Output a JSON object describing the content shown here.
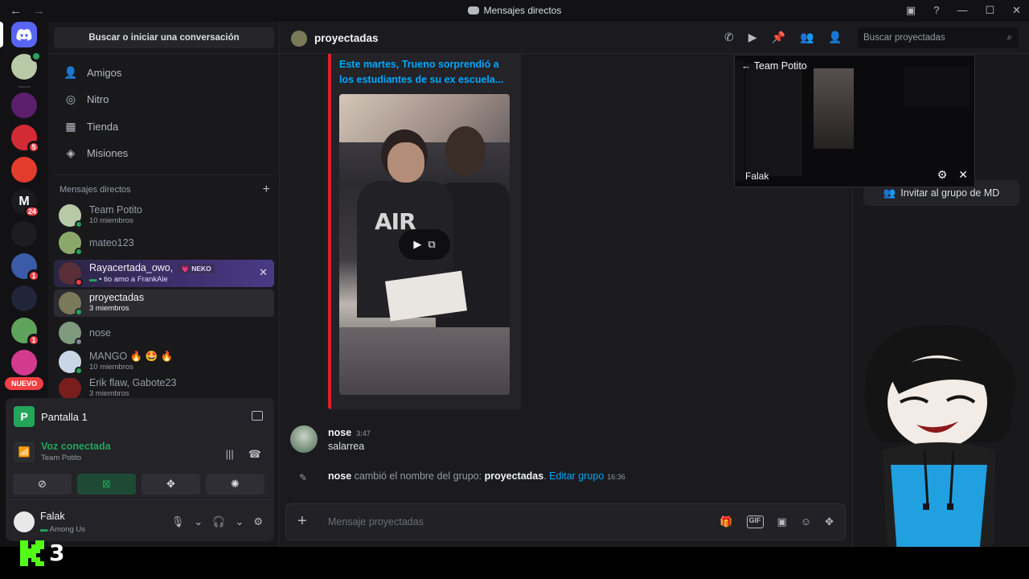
{
  "window": {
    "title": "Mensajes directos"
  },
  "sidebar": {
    "search_label": "Buscar o iniciar una conversación",
    "nav": [
      {
        "label": "Amigos",
        "icon": "friends-icon"
      },
      {
        "label": "Nitro",
        "icon": "nitro-icon"
      },
      {
        "label": "Tienda",
        "icon": "shop-icon"
      },
      {
        "label": "Misiones",
        "icon": "quests-icon"
      }
    ],
    "dm_header": "Mensajes directos",
    "dms": [
      {
        "name": "Team Potito",
        "sub": "10 miembros"
      },
      {
        "name": "mateo123",
        "sub": ""
      },
      {
        "name": "Rayacertada_owo,",
        "sub": "• tio amo a FrankAle",
        "tag": "NEKO"
      },
      {
        "name": "proyectadas",
        "sub": "3 miembros"
      },
      {
        "name": "nose",
        "sub": ""
      },
      {
        "name": "MANGO 🔥 🤩 🔥",
        "sub": "10 miembros"
      },
      {
        "name": "Erik flaw, Gabote23",
        "sub": "3 miembros"
      }
    ]
  },
  "rail": {
    "new_label": "NUEVO",
    "badges": [
      "5",
      "24",
      "1",
      "1"
    ]
  },
  "share_panel": {
    "title": "Pantalla 1",
    "voice_status": "Voz conectada",
    "voice_channel": "Team Potito"
  },
  "user_panel": {
    "name": "Falak",
    "status": "Among Us"
  },
  "chat": {
    "channel_name": "proyectadas",
    "search_placeholder": "Buscar proyectadas",
    "embed_title": "Este martes, Trueno sorprendió a los estudiantes de su ex escuela...",
    "video_text": "AIR",
    "message": {
      "author": "nose",
      "time": "3:47",
      "text": "salarrea"
    },
    "system": {
      "actor": "nose",
      "action": " cambió el nombre del grupo: ",
      "group": "proyectadas",
      "link": "Editar grupo",
      "time": "16:36"
    },
    "composer_placeholder": "Mensaje proyectadas"
  },
  "right_panel": {
    "invite_label": "Invitar al grupo de MD"
  },
  "popout": {
    "title": "Team Potito",
    "user": "Falak"
  },
  "overlay": {
    "kick_number": "3"
  },
  "colors": {
    "accent": "#5865f2",
    "online": "#23a55a",
    "danger": "#f23f43",
    "link": "#00a8fc",
    "kick": "#53fc18"
  }
}
